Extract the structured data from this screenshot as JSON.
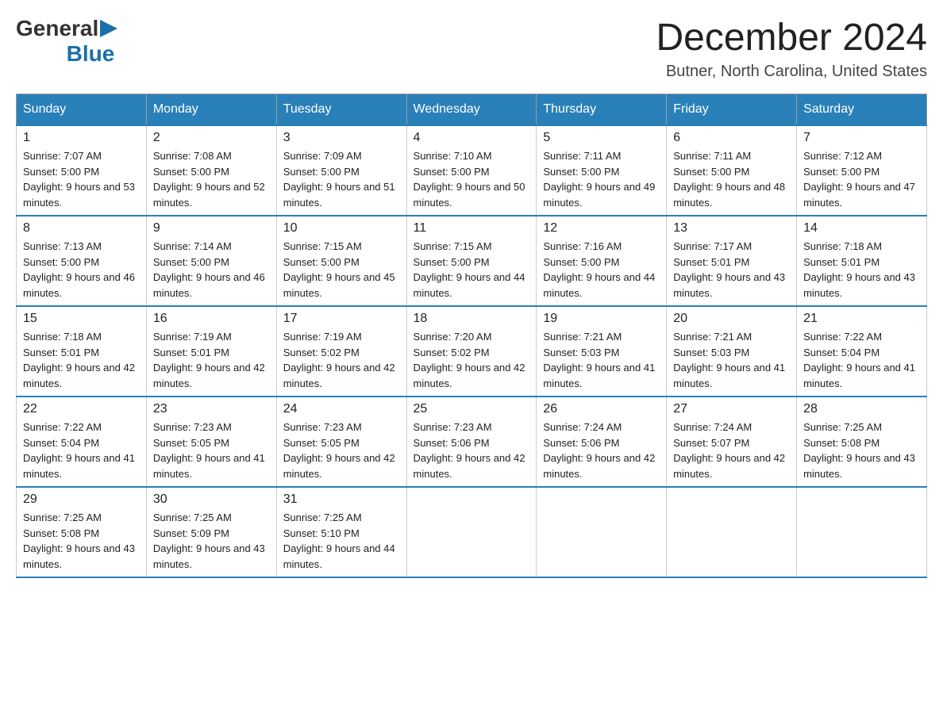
{
  "logo": {
    "general": "General",
    "blue": "Blue",
    "arrow": "▶"
  },
  "header": {
    "month_year": "December 2024",
    "location": "Butner, North Carolina, United States"
  },
  "weekdays": [
    "Sunday",
    "Monday",
    "Tuesday",
    "Wednesday",
    "Thursday",
    "Friday",
    "Saturday"
  ],
  "weeks": [
    [
      {
        "day": "1",
        "sunrise": "7:07 AM",
        "sunset": "5:00 PM",
        "daylight": "9 hours and 53 minutes."
      },
      {
        "day": "2",
        "sunrise": "7:08 AM",
        "sunset": "5:00 PM",
        "daylight": "9 hours and 52 minutes."
      },
      {
        "day": "3",
        "sunrise": "7:09 AM",
        "sunset": "5:00 PM",
        "daylight": "9 hours and 51 minutes."
      },
      {
        "day": "4",
        "sunrise": "7:10 AM",
        "sunset": "5:00 PM",
        "daylight": "9 hours and 50 minutes."
      },
      {
        "day": "5",
        "sunrise": "7:11 AM",
        "sunset": "5:00 PM",
        "daylight": "9 hours and 49 minutes."
      },
      {
        "day": "6",
        "sunrise": "7:11 AM",
        "sunset": "5:00 PM",
        "daylight": "9 hours and 48 minutes."
      },
      {
        "day": "7",
        "sunrise": "7:12 AM",
        "sunset": "5:00 PM",
        "daylight": "9 hours and 47 minutes."
      }
    ],
    [
      {
        "day": "8",
        "sunrise": "7:13 AM",
        "sunset": "5:00 PM",
        "daylight": "9 hours and 46 minutes."
      },
      {
        "day": "9",
        "sunrise": "7:14 AM",
        "sunset": "5:00 PM",
        "daylight": "9 hours and 46 minutes."
      },
      {
        "day": "10",
        "sunrise": "7:15 AM",
        "sunset": "5:00 PM",
        "daylight": "9 hours and 45 minutes."
      },
      {
        "day": "11",
        "sunrise": "7:15 AM",
        "sunset": "5:00 PM",
        "daylight": "9 hours and 44 minutes."
      },
      {
        "day": "12",
        "sunrise": "7:16 AM",
        "sunset": "5:00 PM",
        "daylight": "9 hours and 44 minutes."
      },
      {
        "day": "13",
        "sunrise": "7:17 AM",
        "sunset": "5:01 PM",
        "daylight": "9 hours and 43 minutes."
      },
      {
        "day": "14",
        "sunrise": "7:18 AM",
        "sunset": "5:01 PM",
        "daylight": "9 hours and 43 minutes."
      }
    ],
    [
      {
        "day": "15",
        "sunrise": "7:18 AM",
        "sunset": "5:01 PM",
        "daylight": "9 hours and 42 minutes."
      },
      {
        "day": "16",
        "sunrise": "7:19 AM",
        "sunset": "5:01 PM",
        "daylight": "9 hours and 42 minutes."
      },
      {
        "day": "17",
        "sunrise": "7:19 AM",
        "sunset": "5:02 PM",
        "daylight": "9 hours and 42 minutes."
      },
      {
        "day": "18",
        "sunrise": "7:20 AM",
        "sunset": "5:02 PM",
        "daylight": "9 hours and 42 minutes."
      },
      {
        "day": "19",
        "sunrise": "7:21 AM",
        "sunset": "5:03 PM",
        "daylight": "9 hours and 41 minutes."
      },
      {
        "day": "20",
        "sunrise": "7:21 AM",
        "sunset": "5:03 PM",
        "daylight": "9 hours and 41 minutes."
      },
      {
        "day": "21",
        "sunrise": "7:22 AM",
        "sunset": "5:04 PM",
        "daylight": "9 hours and 41 minutes."
      }
    ],
    [
      {
        "day": "22",
        "sunrise": "7:22 AM",
        "sunset": "5:04 PM",
        "daylight": "9 hours and 41 minutes."
      },
      {
        "day": "23",
        "sunrise": "7:23 AM",
        "sunset": "5:05 PM",
        "daylight": "9 hours and 41 minutes."
      },
      {
        "day": "24",
        "sunrise": "7:23 AM",
        "sunset": "5:05 PM",
        "daylight": "9 hours and 42 minutes."
      },
      {
        "day": "25",
        "sunrise": "7:23 AM",
        "sunset": "5:06 PM",
        "daylight": "9 hours and 42 minutes."
      },
      {
        "day": "26",
        "sunrise": "7:24 AM",
        "sunset": "5:06 PM",
        "daylight": "9 hours and 42 minutes."
      },
      {
        "day": "27",
        "sunrise": "7:24 AM",
        "sunset": "5:07 PM",
        "daylight": "9 hours and 42 minutes."
      },
      {
        "day": "28",
        "sunrise": "7:25 AM",
        "sunset": "5:08 PM",
        "daylight": "9 hours and 43 minutes."
      }
    ],
    [
      {
        "day": "29",
        "sunrise": "7:25 AM",
        "sunset": "5:08 PM",
        "daylight": "9 hours and 43 minutes."
      },
      {
        "day": "30",
        "sunrise": "7:25 AM",
        "sunset": "5:09 PM",
        "daylight": "9 hours and 43 minutes."
      },
      {
        "day": "31",
        "sunrise": "7:25 AM",
        "sunset": "5:10 PM",
        "daylight": "9 hours and 44 minutes."
      },
      null,
      null,
      null,
      null
    ]
  ],
  "labels": {
    "sunrise": "Sunrise:",
    "sunset": "Sunset:",
    "daylight": "Daylight:"
  }
}
